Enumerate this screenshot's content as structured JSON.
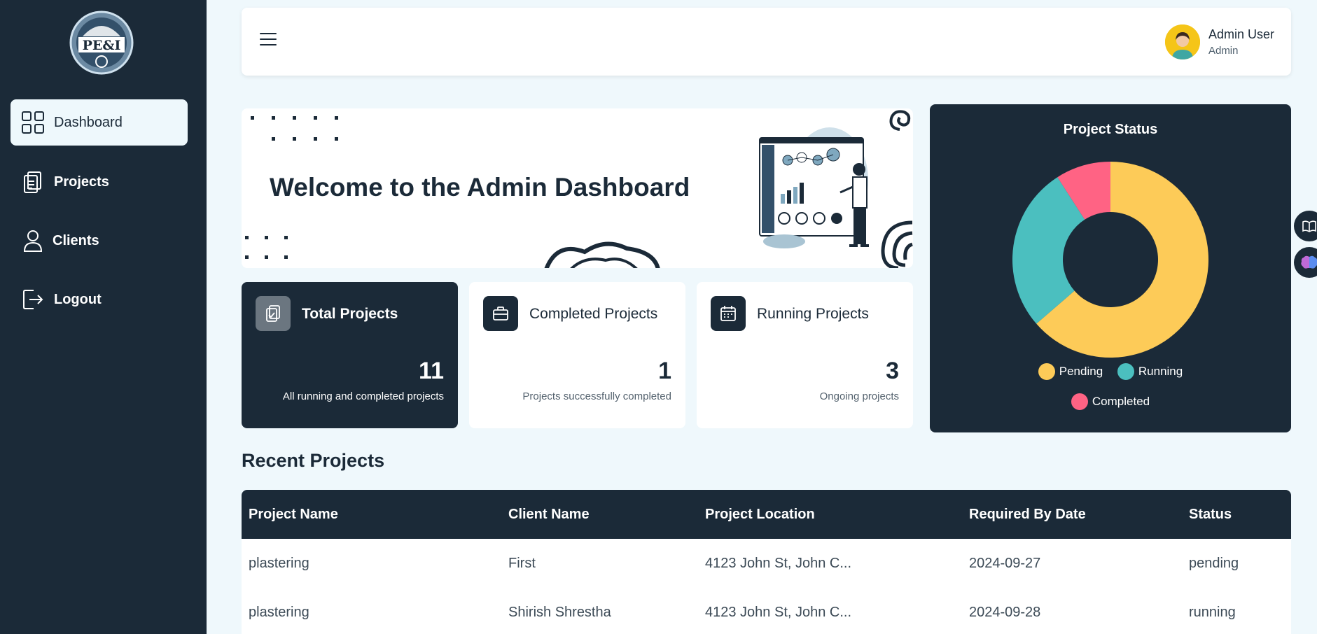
{
  "sidebar": {
    "items": [
      {
        "label": "Dashboard",
        "icon": "grid-icon"
      },
      {
        "label": "Projects",
        "icon": "clipboard-icon"
      },
      {
        "label": "Clients",
        "icon": "user-icon"
      },
      {
        "label": "Logout",
        "icon": "logout-icon"
      }
    ],
    "active_index": 0,
    "logo_text": "PE&I"
  },
  "header": {
    "user_name": "Admin User",
    "user_role": "Admin"
  },
  "welcome": {
    "title": "Welcome to the Admin Dashboard"
  },
  "cards": [
    {
      "title": "Total Projects",
      "value": "11",
      "desc": "All running and completed projects",
      "icon": "clipboard-check-icon"
    },
    {
      "title": "Completed Projects",
      "value": "1",
      "desc": "Projects successfully completed",
      "icon": "briefcase-icon"
    },
    {
      "title": "Running Projects",
      "value": "3",
      "desc": "Ongoing projects",
      "icon": "calendar-icon"
    }
  ],
  "chart_data": {
    "type": "pie",
    "title": "Project Status",
    "categories": [
      "Pending",
      "Running",
      "Completed"
    ],
    "values": [
      7,
      3,
      1
    ],
    "colors": [
      "#fdcb58",
      "#4bbfbf",
      "#ff6384"
    ],
    "donut": true,
    "legend_position": "bottom"
  },
  "recent": {
    "title": "Recent Projects",
    "columns": [
      "Project Name",
      "Client Name",
      "Project Location",
      "Required By Date",
      "Status"
    ],
    "rows": [
      [
        "plastering",
        "First",
        "4123 John St, John C...",
        "2024-09-27",
        "pending"
      ],
      [
        "plastering",
        "Shirish Shrestha",
        "4123 John St, John C...",
        "2024-09-28",
        "running"
      ]
    ]
  },
  "colors": {
    "primary": "#1b2a38",
    "background": "#eff8fc"
  }
}
